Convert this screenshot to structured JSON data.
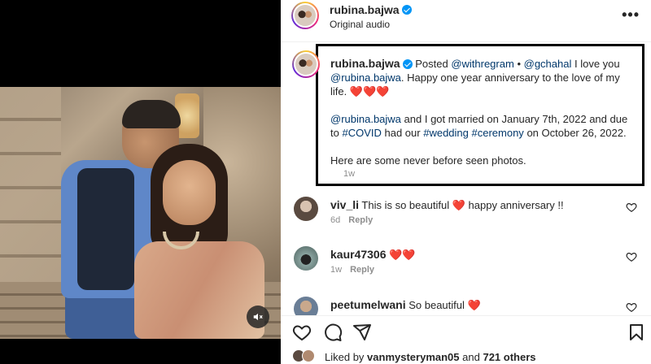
{
  "media": {
    "icons": {
      "mute": "speaker-muted-icon"
    }
  },
  "header": {
    "username": "rubina.bajwa",
    "subtitle": "Original audio",
    "more": "•••"
  },
  "caption": {
    "username": "rubina.bajwa",
    "posted": "Posted",
    "repost_handle": "@withregram",
    "bullet": "•",
    "mention1": "@gchahal",
    "line1_a": "I love you",
    "mention2": "@rubina.bajwa",
    "line1_b": ". Happy one year anniversary to the love of my life.",
    "hearts": "❤️❤️❤️",
    "p2_mention": "@rubina.bajwa",
    "p2_a": "and I got married on January 7th, 2022 and due to",
    "p2_tag1": "#COVID",
    "p2_b": "had our",
    "p2_tag2": "#wedding",
    "p2_tag3": "#ceremony",
    "p2_c": "on October 26, 2022.",
    "p3": "Here are some never before seen photos.",
    "time": "1w"
  },
  "comments": [
    {
      "username": "viv_li",
      "text_a": "This is so beautiful",
      "heart": "❤️",
      "text_b": "happy anniversary !!",
      "time": "6d",
      "reply": "Reply"
    },
    {
      "username": "kaur47306",
      "text_a": "",
      "heart": "❤️❤️",
      "text_b": "",
      "time": "1w",
      "reply": "Reply"
    },
    {
      "username": "peetumelwani",
      "text_a": "So beautiful",
      "heart": "❤️",
      "text_b": "",
      "time": "",
      "reply": ""
    }
  ],
  "actions": {
    "icons": [
      "heart-outline-icon",
      "comment-icon",
      "share-icon",
      "bookmark-icon"
    ]
  },
  "likes": {
    "prefix": "Liked by",
    "user": "vanmysteryman05",
    "middle": "and",
    "others": "721 others"
  },
  "colors": {
    "link": "#00376b",
    "verified": "#0095f6",
    "heart": "#e0241b",
    "muted": "#8e8e8e"
  }
}
